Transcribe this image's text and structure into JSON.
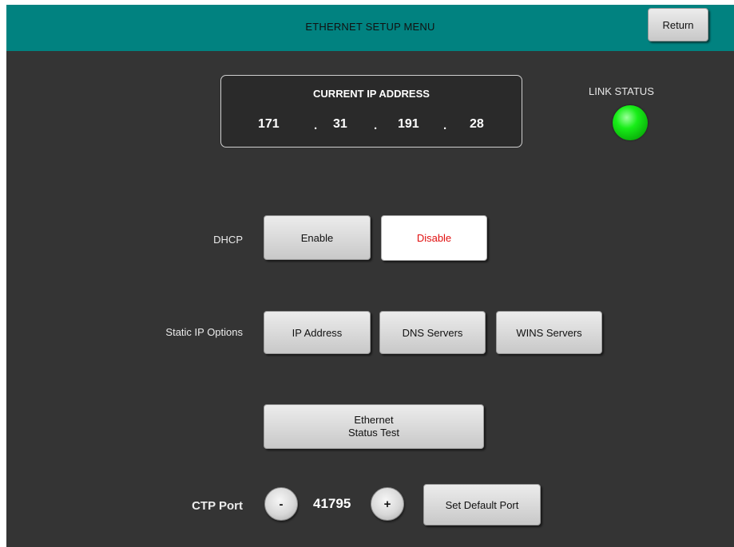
{
  "header": {
    "title": "ETHERNET SETUP MENU",
    "return_label": "Return"
  },
  "current_ip": {
    "title": "CURRENT IP ADDRESS",
    "octets": [
      "171",
      "31",
      "191",
      "28"
    ],
    "separator": "."
  },
  "link_status": {
    "label": "LINK STATUS",
    "state": "connected",
    "color": "#19e619"
  },
  "dhcp": {
    "label": "DHCP",
    "enable_label": "Enable",
    "disable_label": "Disable",
    "selected": "Disable",
    "selected_color": "#e10f0f"
  },
  "static_ip": {
    "label": "Static IP Options",
    "ip_address_label": "IP Address",
    "dns_servers_label": "DNS Servers",
    "wins_servers_label": "WINS Servers"
  },
  "status_test": {
    "line1": "Ethernet",
    "line2": "Status Test"
  },
  "ctp_port": {
    "label": "CTP Port",
    "decrement_label": "-",
    "increment_label": "+",
    "value": "41795",
    "set_default_label": "Set Default Port"
  },
  "colors": {
    "header_bg": "#018280",
    "panel_bg": "#343434"
  }
}
